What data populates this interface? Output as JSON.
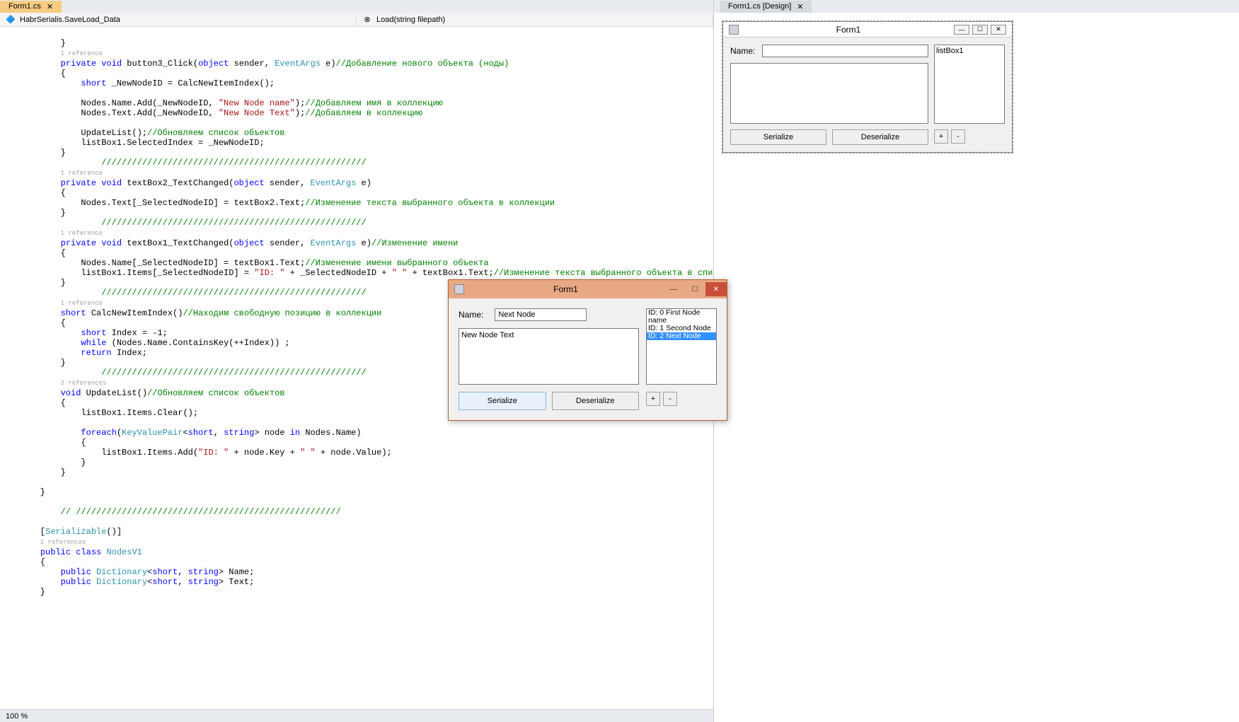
{
  "tabs": {
    "left": {
      "label": "Form1.cs",
      "close": "✕"
    },
    "right": {
      "label": "Form1.cs [Design]",
      "close": "✕"
    }
  },
  "breadcrumb": {
    "left": "HabrSerialis.SaveLoad_Data",
    "right": "Load(string filepath)"
  },
  "status": {
    "zoom": "100 %"
  },
  "refs": {
    "one": "1 reference",
    "two": "2 references"
  },
  "code": {
    "l01": "        }",
    "l03": "        private void button3_Click(object sender, EventArgs e)//Добавление нового объекта (ноды)",
    "l03kw1": "private",
    "l03kw2": "void",
    "l03kw3": "object",
    "l03t": "EventArgs",
    "l03c": "//Добавление нового объекта (ноды)",
    "l04": "        {",
    "l05kw": "short",
    "l05": "            short _NewNodeID = CalcNewItemIndex();",
    "l07": "            Nodes.Name.Add(_NewNodeID, \"New Node name\");//Добавляем имя в коллекцию",
    "l07s": "\"New Node name\"",
    "l07c": "//Добавляем имя в коллекцию",
    "l08": "            Nodes.Text.Add(_NewNodeID, \"New Node Text\");//Добавляем в коллекцию",
    "l08s": "\"New Node Text\"",
    "l08c": "//Добавляем в коллекцию",
    "l10": "            UpdateList();//Обновляем список объектов",
    "l10c": "//Обновляем список объектов",
    "l11": "            listBox1.SelectedIndex = _NewNodeID;",
    "l12": "        }",
    "l13": "        ////////////////////////////////////////////////////",
    "l15": "        private void textBox2_TextChanged(object sender, EventArgs e)",
    "l16": "        {",
    "l17": "            Nodes.Text[_SelectedNodeID] = textBox2.Text;//Изменение текста выбранного объекта в коллекции",
    "l17c": "//Изменение текста выбранного объекта в коллекции",
    "l18": "        }",
    "l19": "        ////////////////////////////////////////////////////",
    "l21": "        private void textBox1_TextChanged(object sender, EventArgs e)//Изменение имени",
    "l21c": "//Изменение имени",
    "l22": "        {",
    "l23": "            Nodes.Name[_SelectedNodeID] = textBox1.Text;//Изменение имени выбранного объекта",
    "l23c": "//Изменение имени выбранного объекта",
    "l24": "            listBox1.Items[_SelectedNodeID] = \"ID: \" + _SelectedNodeID + \" \" + textBox1.Text;//Изменение текста выбранного объекта в списке",
    "l24s": "\"ID: \"",
    "l24s2": "\" \"",
    "l24c": "//Изменение текста выбранного объекта в списке",
    "l25": "        }",
    "l26": "        ////////////////////////////////////////////////////",
    "l28": "        short CalcNewItemIndex()//Находим свободную позицию в коллекции",
    "l28kw": "short",
    "l28c": "//Находим свободную позицию в коллекции",
    "l29": "        {",
    "l30": "            short Index = -1;",
    "l30kw": "short",
    "l31": "            while (Nodes.Name.ContainsKey(++Index)) ;",
    "l31kw": "while",
    "l32": "            return Index;",
    "l32kw": "return",
    "l33": "        }",
    "l34": "        ////////////////////////////////////////////////////",
    "l36": "        void UpdateList()//Обновляем список объектов",
    "l36kw": "void",
    "l36c": "//Обновляем список объектов",
    "l37": "        {",
    "l38": "            listBox1.Items.Clear();",
    "l40": "            foreach(KeyValuePair<short, string> node in Nodes.Name)",
    "l40kw": "foreach",
    "l40t": "KeyValuePair",
    "l40kw2": "short",
    "l40kw3": "string",
    "l40kw4": "in",
    "l41": "            {",
    "l42": "                listBox1.Items.Add(\"ID: \" + node.Key + \" \" + node.Value);",
    "l42s": "\"ID: \"",
    "l42s2": "\" \"",
    "l43": "            }",
    "l44": "        }",
    "l46": "    }",
    "l48": "    // ////////////////////////////////////////////////////",
    "l50": "    [Serializable()]",
    "l50t": "Serializable",
    "l52": "    public class NodesV1",
    "l52kw": "public",
    "l52kw2": "class",
    "l52t": "NodesV1",
    "l53": "    {",
    "l54": "        public Dictionary<short, string> Name;",
    "l54kw": "public",
    "l54t": "Dictionary",
    "l54kw2": "short",
    "l54kw3": "string",
    "l55": "        public Dictionary<short, string> Text;",
    "l56": "    }"
  },
  "designer": {
    "title": "Form1",
    "name_label": "Name:",
    "listbox_placeholder": "listBox1",
    "btn_serialize": "Serialize",
    "btn_deserialize": "Deserialize",
    "btn_plus": "+",
    "btn_minus": "-"
  },
  "run": {
    "title": "Form1",
    "name_label": "Name:",
    "name_value": "Next Node",
    "text_value": "New Node Text",
    "list": [
      {
        "t": "ID: 0 First Node name",
        "sel": false
      },
      {
        "t": "ID: 1 Second Node",
        "sel": false
      },
      {
        "t": "ID: 2 Next Node",
        "sel": true
      }
    ],
    "btn_serialize": "Serialize",
    "btn_deserialize": "Deserialize",
    "btn_plus": "+",
    "btn_minus": "-",
    "win_min": "—",
    "win_max": "☐",
    "win_close": "✕"
  }
}
